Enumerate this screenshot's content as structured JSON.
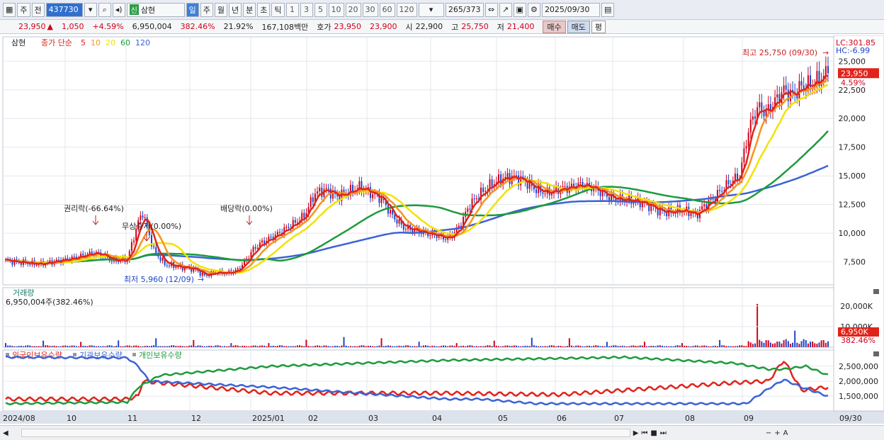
{
  "toolbar": {
    "market": "주",
    "prev": "전",
    "code": "437730",
    "name": "삼현",
    "name_badge": "신",
    "periods": [
      "일",
      "주",
      "월",
      "년",
      "분",
      "초",
      "틱"
    ],
    "intervals": [
      "1",
      "3",
      "5",
      "10",
      "20",
      "30",
      "60",
      "120"
    ],
    "count": "265",
    "count_total": "/373",
    "date": "2025/09/30"
  },
  "quote": {
    "price": "23,950",
    "change": "1,050",
    "change_pct": "+4.59%",
    "volume": "6,950,004",
    "vol_ratio": "382.46%",
    "turnover": "21.92%",
    "amount": "167,108백만",
    "ask_label": "호가",
    "ask": "23,950",
    "bid": "23,900",
    "open_label": "시",
    "open": "22,900",
    "high_label": "고",
    "high": "25,750",
    "low_label": "저",
    "low": "21,400",
    "buy": "매수",
    "sell": "매도",
    "avg": "평"
  },
  "chart_data": {
    "type": "candlestick",
    "title": "삼현",
    "legend": {
      "label": "종가 단순",
      "periods": [
        "5",
        "10",
        "20",
        "60",
        "120"
      ]
    },
    "colors": {
      "ma5": "#e0241b",
      "ma10": "#f5941f",
      "ma20": "#f2e200",
      "ma60": "#1d9b3c",
      "ma120": "#3b63d6",
      "up": "#d0021b",
      "down": "#1d45c8"
    },
    "ylim": [
      5500,
      26500
    ],
    "y_ticks": [
      "25,000",
      "22,500",
      "20,000",
      "17,500",
      "15,000",
      "12,500",
      "10,000",
      "7,500"
    ],
    "x_labels": [
      "2024/08",
      "10",
      "11",
      "12",
      "2025/01",
      "02",
      "03",
      "04",
      "05",
      "06",
      "07",
      "08",
      "09",
      "09/30"
    ],
    "right_labels": {
      "lc": "LC:301.85",
      "hc": "HC:-6.99",
      "price": "23,950",
      "pct": "4.59%"
    },
    "annotations": {
      "high": "최고 25,750 (09/30)",
      "low": "최저 5,960 (12/09)",
      "rights": "권리락(-66.64%)",
      "bonus": "무상증자(0.00%)",
      "dividend": "배당락(0.00%)"
    },
    "close_keypoints": [
      [
        0,
        7600
      ],
      [
        15,
        7300
      ],
      [
        30,
        7800
      ],
      [
        40,
        8300
      ],
      [
        45,
        8000
      ],
      [
        48,
        7600
      ],
      [
        55,
        7700
      ],
      [
        60,
        11000
      ],
      [
        62,
        11800
      ],
      [
        64,
        10500
      ],
      [
        67,
        8500
      ],
      [
        72,
        7300
      ],
      [
        80,
        7000
      ],
      [
        85,
        6900
      ],
      [
        90,
        6300
      ],
      [
        95,
        6600
      ],
      [
        100,
        6500
      ],
      [
        105,
        6800
      ],
      [
        108,
        7500
      ],
      [
        110,
        8000
      ],
      [
        112,
        8600
      ],
      [
        116,
        9200
      ],
      [
        122,
        9800
      ],
      [
        130,
        10800
      ],
      [
        135,
        11500
      ],
      [
        140,
        13500
      ],
      [
        145,
        13800
      ],
      [
        150,
        13200
      ],
      [
        155,
        13600
      ],
      [
        160,
        14000
      ],
      [
        165,
        13500
      ],
      [
        170,
        13000
      ],
      [
        175,
        11500
      ],
      [
        180,
        10500
      ],
      [
        190,
        10000
      ],
      [
        195,
        9800
      ],
      [
        200,
        9500
      ],
      [
        205,
        10500
      ],
      [
        210,
        12500
      ],
      [
        215,
        13500
      ],
      [
        220,
        14300
      ],
      [
        225,
        14800
      ],
      [
        230,
        14900
      ],
      [
        235,
        14500
      ],
      [
        240,
        13800
      ],
      [
        245,
        13500
      ],
      [
        250,
        13800
      ],
      [
        255,
        14000
      ],
      [
        260,
        14200
      ],
      [
        265,
        14000
      ],
      [
        270,
        13500
      ],
      [
        275,
        13000
      ],
      [
        280,
        12900
      ],
      [
        285,
        12800
      ],
      [
        290,
        12500
      ],
      [
        295,
        12000
      ],
      [
        300,
        11800
      ],
      [
        305,
        12000
      ],
      [
        310,
        11800
      ],
      [
        312,
        11500
      ],
      [
        315,
        12200
      ],
      [
        320,
        13000
      ],
      [
        325,
        14000
      ],
      [
        328,
        14500
      ],
      [
        332,
        15000
      ],
      [
        336,
        19000
      ],
      [
        340,
        21000
      ],
      [
        344,
        20500
      ],
      [
        348,
        21500
      ],
      [
        352,
        22500
      ],
      [
        356,
        22000
      ],
      [
        360,
        22800
      ],
      [
        365,
        23000
      ],
      [
        372,
        23950
      ]
    ],
    "volume": {
      "title": "거래량",
      "value": "6,950,004주(382.46%)",
      "y_ticks": [
        "20,000K",
        "10,000K"
      ],
      "last_label": "6,950K",
      "last_pct": "382.46%"
    },
    "holdings": {
      "legend": [
        "외국인보유수량",
        "기관보유수량",
        "개인보유수량"
      ],
      "colors": [
        "#e0241b",
        "#3b63d6",
        "#1d9b3c"
      ],
      "y_ticks": [
        "2,500,000",
        "2,000,000",
        "1,500,000"
      ]
    }
  },
  "scrollbar": {
    "controls": [
      "▶",
      "⏮",
      "■",
      "⏭"
    ],
    "zoom": [
      "−",
      "+",
      "A"
    ]
  }
}
